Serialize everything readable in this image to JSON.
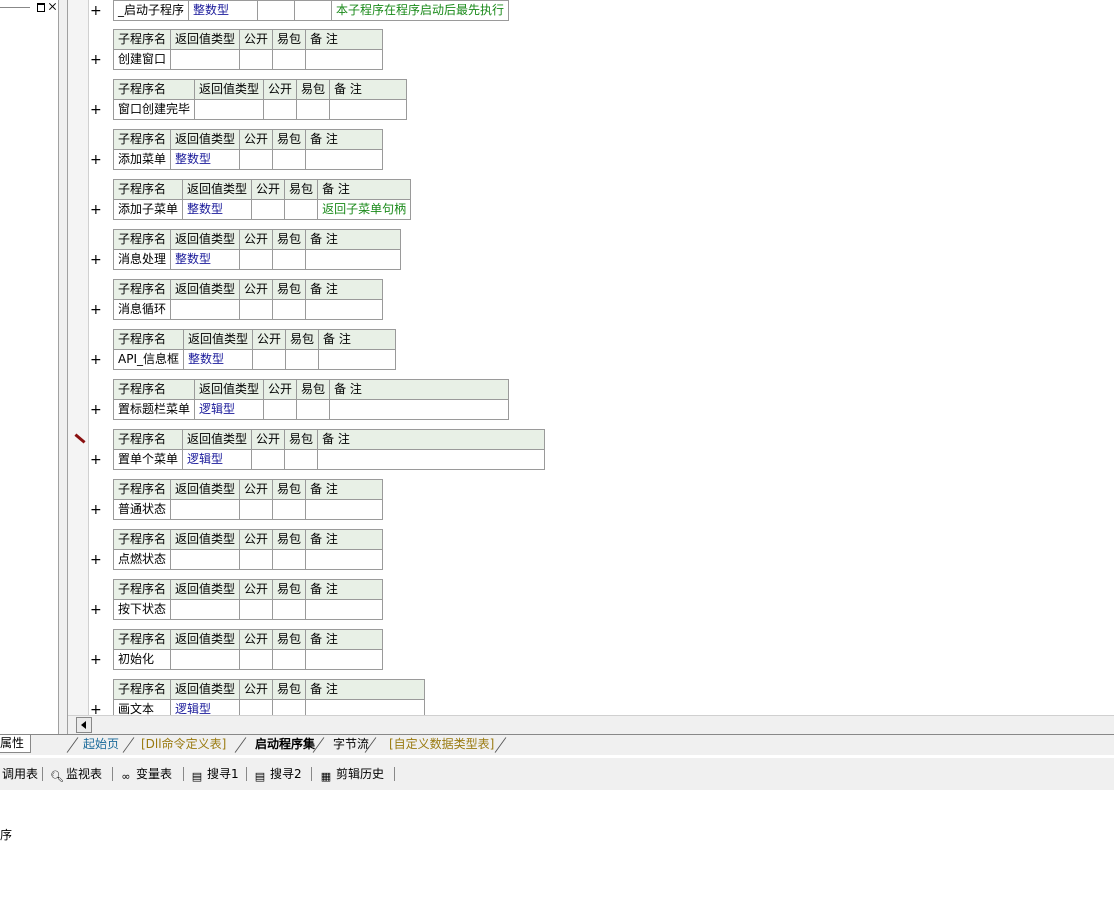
{
  "window_controls": {
    "restore": "restore-icon",
    "close": "close-icon"
  },
  "headers": {
    "name": "子程序名",
    "ret": "返回值类型",
    "pub": "公开",
    "easy": "易包",
    "note": "备 注"
  },
  "subroutines": [
    {
      "name": "_启动子程序",
      "ret": "整数型",
      "note": "本子程序在程序启动后最先执行"
    },
    {
      "name": "创建窗口",
      "ret": "",
      "note": ""
    },
    {
      "name": "窗口创建完毕",
      "ret": "",
      "note": ""
    },
    {
      "name": "添加菜单",
      "ret": "整数型",
      "note": ""
    },
    {
      "name": "添加子菜单",
      "ret": "整数型",
      "note": "返回子菜单句柄"
    },
    {
      "name": "消息处理",
      "ret": "整数型",
      "note": ""
    },
    {
      "name": "消息循环",
      "ret": "",
      "note": ""
    },
    {
      "name": "API_信息框",
      "ret": "整数型",
      "note": ""
    },
    {
      "name": "置标题栏菜单",
      "ret": "逻辑型",
      "note": ""
    },
    {
      "name": "置单个菜单",
      "ret": "逻辑型",
      "note": ""
    },
    {
      "name": "普通状态",
      "ret": "",
      "note": ""
    },
    {
      "name": "点燃状态",
      "ret": "",
      "note": ""
    },
    {
      "name": "按下状态",
      "ret": "",
      "note": ""
    },
    {
      "name": "初始化",
      "ret": "",
      "note": ""
    },
    {
      "name": "画文本",
      "ret": "逻辑型",
      "note": ""
    }
  ],
  "tabs": {
    "properties": "属性",
    "home": "起始页",
    "dll": "[Dll命令定义表]",
    "startup": "启动程序集",
    "bytestream": "字节流",
    "datatypes": "[自定义数据类型表]"
  },
  "toolbar": {
    "calltable": "调用表",
    "watch": "监视表",
    "vars": "变量表",
    "search1": "搜寻1",
    "search2": "搜寻2",
    "cliphistory": "剪辑历史"
  },
  "output": {
    "text": "序"
  }
}
